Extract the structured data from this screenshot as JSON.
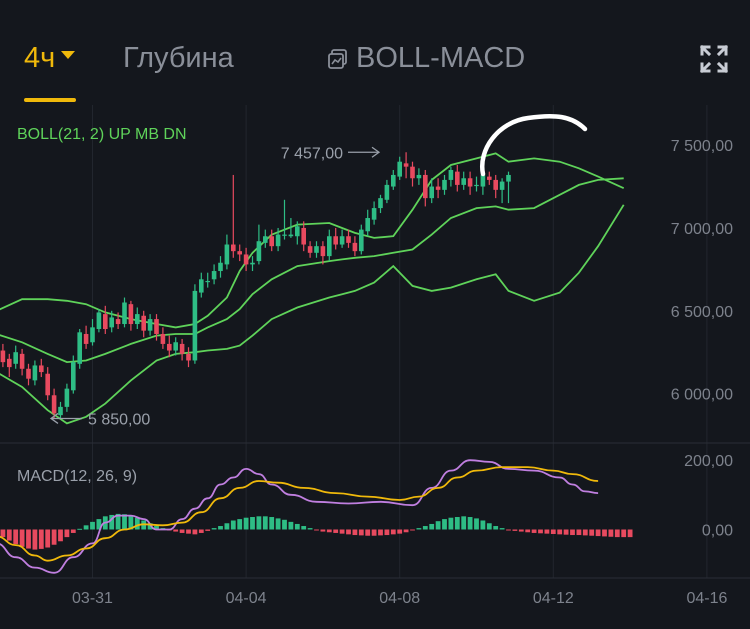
{
  "tabs": {
    "interval_label": "4ч",
    "depth_label": "Глубина",
    "indicator_label": "BOLL-MACD"
  },
  "icons": {
    "caret": "caret-down-icon",
    "indicator": "indicator-icon",
    "fullscreen": "fullscreen-icon"
  },
  "colors": {
    "accent": "#f0b90b",
    "up": "#2ebd85",
    "down": "#e84a5f",
    "boll": "#5fd35a",
    "macd_line": "#c07fe0",
    "signal_line": "#f0b90b",
    "label": "#7d828c",
    "grid": "#22262e"
  },
  "chart_data": [
    {
      "type": "candlestick",
      "title": "BOLL(21, 2) UP MB DN",
      "y_ticks": [
        "7 500,00",
        "7 000,00",
        "6 500,00",
        "6 000,00"
      ],
      "ylim": [
        5720,
        7700
      ],
      "y_tick_values": [
        7500,
        7000,
        6500,
        6000
      ],
      "annotations": {
        "high_label": "7 457,00",
        "high_value": 7457,
        "low_label": "5 850,00",
        "low_value": 5850
      },
      "x_tick_labels": [
        "03-31",
        "04-04",
        "04-08",
        "04-12",
        "04-16"
      ],
      "x_tick_index": [
        15,
        39,
        63,
        87,
        111
      ],
      "candles": [
        [
          6240,
          6250,
          6280,
          6200
        ],
        [
          6260,
          6190,
          6300,
          6160
        ],
        [
          6210,
          6160,
          6240,
          6100
        ],
        [
          6180,
          6250,
          6290,
          6150
        ],
        [
          6240,
          6150,
          6270,
          6110
        ],
        [
          6150,
          6090,
          6180,
          6050
        ],
        [
          6080,
          6170,
          6200,
          6050
        ],
        [
          6170,
          6130,
          6210,
          6100
        ],
        [
          6120,
          5990,
          6160,
          5960
        ],
        [
          5990,
          5880,
          6030,
          5850
        ],
        [
          5870,
          5920,
          5950,
          5850
        ],
        [
          5920,
          6030,
          6060,
          5890
        ],
        [
          6020,
          6190,
          6230,
          6000
        ],
        [
          6180,
          6370,
          6390,
          6150
        ],
        [
          6360,
          6300,
          6410,
          6270
        ],
        [
          6310,
          6400,
          6450,
          6290
        ],
        [
          6390,
          6490,
          6510,
          6370
        ],
        [
          6480,
          6390,
          6530,
          6360
        ],
        [
          6400,
          6460,
          6500,
          6370
        ],
        [
          6450,
          6420,
          6490,
          6390
        ],
        [
          6420,
          6550,
          6580,
          6400
        ],
        [
          6540,
          6420,
          6560,
          6380
        ],
        [
          6420,
          6480,
          6520,
          6390
        ],
        [
          6470,
          6380,
          6500,
          6340
        ],
        [
          6380,
          6450,
          6480,
          6350
        ],
        [
          6450,
          6360,
          6480,
          6320
        ],
        [
          6360,
          6300,
          6400,
          6270
        ],
        [
          6300,
          6260,
          6350,
          6220
        ],
        [
          6260,
          6310,
          6340,
          6230
        ],
        [
          6300,
          6240,
          6330,
          6200
        ],
        [
          6240,
          6200,
          6280,
          6160
        ],
        [
          6200,
          6620,
          6660,
          6180
        ],
        [
          6610,
          6690,
          6730,
          6580
        ],
        [
          6680,
          6680,
          6730,
          6640
        ],
        [
          6690,
          6740,
          6780,
          6660
        ],
        [
          6740,
          6790,
          6830,
          6700
        ],
        [
          6780,
          6900,
          6960,
          6750
        ],
        [
          6900,
          6860,
          7320,
          6820
        ],
        [
          6860,
          6840,
          6900,
          6800
        ],
        [
          6840,
          6780,
          6880,
          6740
        ],
        [
          6780,
          6790,
          6830,
          6740
        ],
        [
          6800,
          6920,
          7020,
          6780
        ],
        [
          6910,
          6950,
          6990,
          6880
        ],
        [
          6950,
          6890,
          6990,
          6860
        ],
        [
          6890,
          6960,
          7000,
          6860
        ],
        [
          6960,
          6960,
          7170,
          6930
        ],
        [
          6950,
          6960,
          7060,
          6940
        ],
        [
          6950,
          7010,
          7040,
          6900
        ],
        [
          7000,
          6900,
          7040,
          6860
        ],
        [
          6890,
          6850,
          6920,
          6820
        ],
        [
          6850,
          6890,
          6920,
          6820
        ],
        [
          6890,
          6830,
          6920,
          6780
        ],
        [
          6830,
          6950,
          6990,
          6800
        ],
        [
          6950,
          6900,
          7000,
          6870
        ],
        [
          6900,
          6950,
          6990,
          6880
        ],
        [
          6950,
          6910,
          6990,
          6880
        ],
        [
          6910,
          6860,
          6950,
          6830
        ],
        [
          6860,
          6990,
          7020,
          6840
        ],
        [
          6980,
          7060,
          7110,
          6950
        ],
        [
          7050,
          7120,
          7160,
          7020
        ],
        [
          7120,
          7180,
          7200,
          7090
        ],
        [
          7170,
          7260,
          7290,
          7150
        ],
        [
          7250,
          7320,
          7350,
          7230
        ],
        [
          7310,
          7400,
          7430,
          7290
        ],
        [
          7390,
          7370,
          7457,
          7300
        ],
        [
          7370,
          7300,
          7400,
          7250
        ],
        [
          7300,
          7320,
          7360,
          7260
        ],
        [
          7320,
          7180,
          7350,
          7130
        ],
        [
          7180,
          7250,
          7300,
          7150
        ],
        [
          7250,
          7230,
          7300,
          7180
        ],
        [
          7230,
          7290,
          7320,
          7200
        ],
        [
          7290,
          7350,
          7370,
          7250
        ],
        [
          7340,
          7260,
          7380,
          7220
        ],
        [
          7260,
          7300,
          7340,
          7230
        ],
        [
          7300,
          7250,
          7340,
          7200
        ],
        [
          7260,
          7260,
          7310,
          7220
        ],
        [
          7250,
          7320,
          7350,
          7200
        ],
        [
          7310,
          7290,
          7340,
          7260
        ],
        [
          7290,
          7230,
          7320,
          7180
        ],
        [
          7230,
          7280,
          7300,
          7150
        ],
        [
          7280,
          7320,
          7340,
          7150
        ]
      ],
      "boll_upper": [
        [
          0,
          6500
        ],
        [
          4,
          6570
        ],
        [
          8,
          6570
        ],
        [
          11,
          6560
        ],
        [
          14,
          6540
        ],
        [
          17,
          6490
        ],
        [
          21,
          6450
        ],
        [
          25,
          6420
        ],
        [
          28,
          6400
        ],
        [
          31,
          6420
        ],
        [
          33,
          6470
        ],
        [
          36,
          6580
        ],
        [
          38,
          6740
        ],
        [
          40,
          6850
        ],
        [
          43,
          6960
        ],
        [
          47,
          7020
        ],
        [
          52,
          7030
        ],
        [
          54,
          7000
        ],
        [
          56,
          6970
        ],
        [
          59,
          6940
        ],
        [
          62,
          6950
        ],
        [
          65,
          7110
        ],
        [
          68,
          7290
        ],
        [
          71,
          7380
        ],
        [
          75,
          7420
        ],
        [
          78,
          7450
        ],
        [
          80,
          7400
        ],
        [
          84,
          7420
        ],
        [
          88,
          7400
        ],
        [
          91,
          7360
        ],
        [
          94,
          7310
        ],
        [
          98,
          7240
        ]
      ],
      "boll_mid": [
        [
          0,
          6360
        ],
        [
          4,
          6310
        ],
        [
          8,
          6240
        ],
        [
          11,
          6190
        ],
        [
          14,
          6200
        ],
        [
          17,
          6240
        ],
        [
          21,
          6300
        ],
        [
          25,
          6350
        ],
        [
          28,
          6360
        ],
        [
          31,
          6360
        ],
        [
          33,
          6400
        ],
        [
          36,
          6450
        ],
        [
          38,
          6510
        ],
        [
          40,
          6600
        ],
        [
          43,
          6690
        ],
        [
          47,
          6770
        ],
        [
          52,
          6800
        ],
        [
          54,
          6810
        ],
        [
          56,
          6820
        ],
        [
          59,
          6830
        ],
        [
          62,
          6850
        ],
        [
          65,
          6870
        ],
        [
          68,
          6960
        ],
        [
          71,
          7060
        ],
        [
          75,
          7120
        ],
        [
          78,
          7130
        ],
        [
          80,
          7110
        ],
        [
          84,
          7120
        ],
        [
          88,
          7200
        ],
        [
          91,
          7260
        ],
        [
          94,
          7290
        ],
        [
          98,
          7300
        ]
      ],
      "boll_lower": [
        [
          0,
          6130
        ],
        [
          4,
          6040
        ],
        [
          8,
          5900
        ],
        [
          11,
          5820
        ],
        [
          14,
          5860
        ],
        [
          17,
          5940
        ],
        [
          21,
          6080
        ],
        [
          25,
          6200
        ],
        [
          28,
          6240
        ],
        [
          31,
          6250
        ],
        [
          33,
          6260
        ],
        [
          36,
          6270
        ],
        [
          38,
          6290
        ],
        [
          40,
          6350
        ],
        [
          43,
          6450
        ],
        [
          47,
          6520
        ],
        [
          52,
          6580
        ],
        [
          54,
          6600
        ],
        [
          56,
          6620
        ],
        [
          59,
          6670
        ],
        [
          62,
          6770
        ],
        [
          65,
          6650
        ],
        [
          68,
          6620
        ],
        [
          71,
          6640
        ],
        [
          75,
          6690
        ],
        [
          78,
          6720
        ],
        [
          80,
          6620
        ],
        [
          84,
          6560
        ],
        [
          88,
          6610
        ],
        [
          91,
          6730
        ],
        [
          94,
          6890
        ],
        [
          98,
          7140
        ]
      ]
    },
    {
      "type": "macd",
      "title": "MACD(12, 26, 9)",
      "y_ticks": [
        "200,00",
        "0,00"
      ],
      "y_tick_values": [
        200,
        0
      ],
      "ylim": [
        -140,
        215
      ],
      "histogram": [
        -12,
        -22,
        -32,
        -42,
        -50,
        -55,
        -58,
        -56,
        -52,
        -44,
        -34,
        -22,
        -10,
        2,
        12,
        22,
        30,
        38,
        42,
        45,
        44,
        40,
        34,
        26,
        18,
        10,
        4,
        -2,
        -6,
        -10,
        -12,
        -14,
        -10,
        -4,
        4,
        10,
        18,
        26,
        30,
        34,
        36,
        38,
        38,
        36,
        32,
        28,
        22,
        16,
        10,
        4,
        -2,
        -6,
        -8,
        -10,
        -12,
        -14,
        -16,
        -17,
        -18,
        -18,
        -17,
        -16,
        -14,
        -12,
        -8,
        -2,
        4,
        10,
        16,
        24,
        30,
        34,
        36,
        38,
        36,
        32,
        26,
        18,
        10,
        4,
        -2,
        -4,
        -6,
        -8,
        -10,
        -11,
        -12,
        -13,
        -14,
        -15,
        -16,
        -16,
        -17,
        -18,
        -19,
        -20,
        -21,
        -22,
        -22,
        -22
      ],
      "macd_line": [
        [
          0,
          -40
        ],
        [
          3,
          -80
        ],
        [
          6,
          -110
        ],
        [
          9,
          -125
        ],
        [
          12,
          -80
        ],
        [
          15,
          -40
        ],
        [
          17,
          20
        ],
        [
          19,
          40
        ],
        [
          21,
          40
        ],
        [
          23,
          30
        ],
        [
          25,
          0
        ],
        [
          27,
          0
        ],
        [
          29,
          30
        ],
        [
          31,
          60
        ],
        [
          33,
          90
        ],
        [
          35,
          130
        ],
        [
          37,
          150
        ],
        [
          39,
          175
        ],
        [
          41,
          160
        ],
        [
          43,
          130
        ],
        [
          46,
          100
        ],
        [
          50,
          80
        ],
        [
          55,
          75
        ],
        [
          60,
          80
        ],
        [
          65,
          70
        ],
        [
          68,
          120
        ],
        [
          71,
          170
        ],
        [
          74,
          200
        ],
        [
          77,
          195
        ],
        [
          80,
          175
        ],
        [
          84,
          170
        ],
        [
          88,
          150
        ],
        [
          90,
          130
        ],
        [
          92,
          110
        ],
        [
          94,
          105
        ]
      ],
      "signal_line": [
        [
          0,
          -20
        ],
        [
          3,
          -45
        ],
        [
          6,
          -75
        ],
        [
          8,
          -90
        ],
        [
          11,
          -75
        ],
        [
          14,
          -55
        ],
        [
          17,
          -25
        ],
        [
          20,
          0
        ],
        [
          23,
          15
        ],
        [
          26,
          12
        ],
        [
          29,
          20
        ],
        [
          32,
          50
        ],
        [
          35,
          90
        ],
        [
          38,
          120
        ],
        [
          41,
          140
        ],
        [
          44,
          135
        ],
        [
          48,
          120
        ],
        [
          53,
          105
        ],
        [
          58,
          95
        ],
        [
          63,
          85
        ],
        [
          66,
          95
        ],
        [
          69,
          120
        ],
        [
          72,
          150
        ],
        [
          75,
          170
        ],
        [
          79,
          180
        ],
        [
          83,
          180
        ],
        [
          87,
          170
        ],
        [
          90,
          160
        ],
        [
          94,
          140
        ]
      ]
    }
  ]
}
